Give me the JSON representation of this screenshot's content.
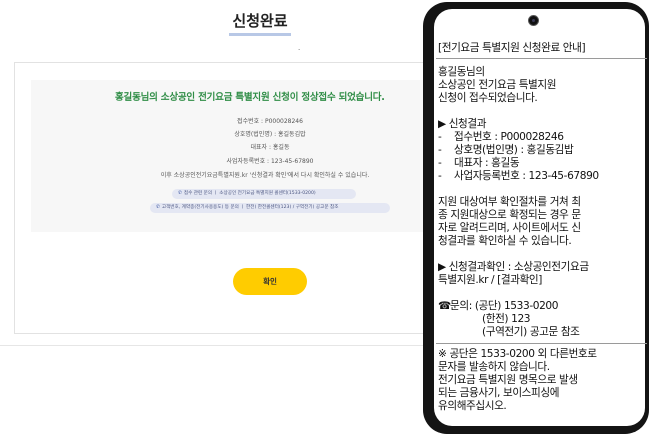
{
  "web": {
    "page_title": "신청완료",
    "stray_dot": ".",
    "headline": "홍길동님의 소상공인 전기요금 특별지원 신청이 정상접수 되었습니다.",
    "info": {
      "receipt": "접수번호 : P000028246",
      "company": "상호명(법인명) : 홍길동김밥",
      "ceo": "대표자 : 홍길동",
      "bizno": "사업자등록번호 : 123-45-67890",
      "note": "이후 소상공인전기요금특별지원.kr '신청결과 확인'에서 다시 확인하실 수 있습니다."
    },
    "pills": [
      "접수 관련 문의 ㅣ 소상공인 전기요금 특별지원 콜센터(1533-0200)",
      "고객번호, 계약종(전기사용용도) 등 문의 ㅣ 한전) 한전콜센터(123) / 구역전기) 공고문 참조"
    ],
    "confirm_label": "확인"
  },
  "sms": {
    "header": "[전기요금 특별지원 신청완료 안내]",
    "greeting": [
      "홍길동님의",
      "소상공인 전기요금 특별지원",
      "신청이 접수되었습니다."
    ],
    "result_title": "▶ 신청결과",
    "result_items": [
      "접수번호 : P000028246",
      "상호명(법인명) : 홍길동김밥",
      "대표자 : 홍길동",
      "사업자등록번호 : 123-45-67890"
    ],
    "paragraph": [
      "지원 대상여부 확인절차를 거쳐 최",
      "종 지원대상으로 확정되는 경우 문",
      "자로 알려드리며, 사이트에서도 신",
      "청결과를 확인하실 수 있습니다."
    ],
    "check_line": [
      "▶ 신청결과확인 : 소상공인전기요금",
      "특별지원.kr / [결과확인]"
    ],
    "contact_icon": "☎",
    "contact": [
      "문의: (공단) 1533-0200",
      "(한전) 123",
      "(구역전기) 공고문 참조"
    ],
    "warning": [
      "※ 공단은 1533-0200 외 다른번호로",
      "문자를 발송하지 않습니다.",
      "전기요금 특별지원 명목으로 발생",
      "되는 금융사기, 보이스피싱에",
      "유의해주십시오."
    ]
  },
  "colors": {
    "headline_green": "#2f8d46",
    "button_yellow": "#ffcc00",
    "pill_bg": "#e4e7f3",
    "phone_frame": "#141414"
  }
}
